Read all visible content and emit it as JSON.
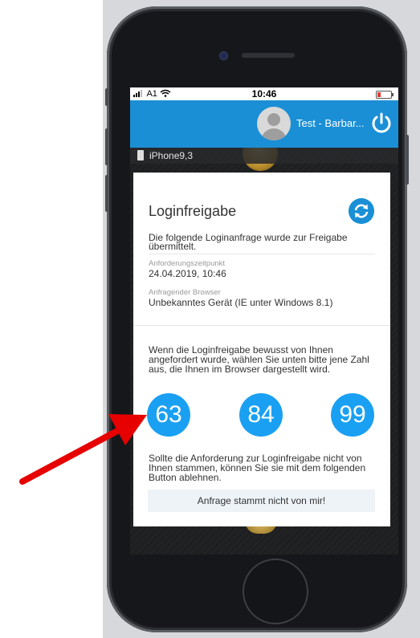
{
  "status_bar": {
    "carrier": "A1",
    "time": "10:46"
  },
  "header": {
    "user_name": "Test - Barbar..."
  },
  "device": {
    "label": "iPhone9,3"
  },
  "card": {
    "title": "Loginfreigabe",
    "intro": [
      "Die folgende Loginanfrage wurde zur Freigabe",
      "übermittelt."
    ],
    "request_time_label": "Anforderungszeitpunkt",
    "request_time_value": "24.04.2019, 10:46",
    "browser_label": "Anfragender Browser",
    "browser_value": "Unbekanntes Gerät (IE unter Windows 8.1)",
    "instruction": [
      "Wenn die Loginfreigabe bewusst von Ihnen",
      "angefordert wurde, wählen Sie unten bitte jene Zahl",
      "aus, die Ihnen im Browser dargestellt wird."
    ],
    "numbers": [
      "63",
      "84",
      "99"
    ],
    "reject_text": [
      "Sollte die Anforderung zur Loginfreigabe nicht von",
      "Ihnen stammen, können Sie sie mit dem folgenden",
      "Button ablehnen."
    ],
    "reject_button": "Anfrage stammt nicht von mir!"
  },
  "colors": {
    "primary": "#1a8fd6",
    "number_circle": "#1aa0f2",
    "arrow": "#e60000"
  },
  "icons": [
    "signal-icon",
    "wifi-icon",
    "battery-icon",
    "avatar-icon",
    "power-icon",
    "device-phone-icon",
    "refresh-icon",
    "annotation-arrow"
  ]
}
